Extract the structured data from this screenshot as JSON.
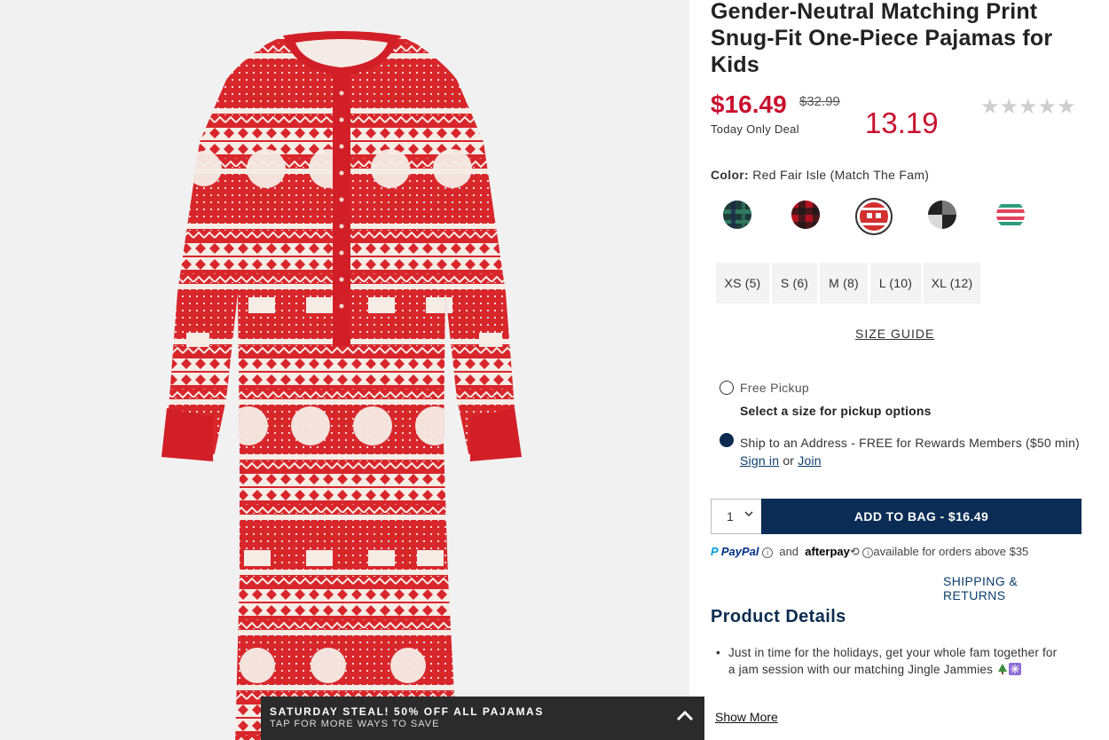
{
  "product": {
    "title": "Gender-Neutral Matching Print Snug-Fit One-Piece Pajamas for Kids",
    "price": "$16.49",
    "original_price": "$32.99",
    "deal_label": "Today Only Deal",
    "promo_price": "13.19",
    "rating_stars": "★★★★★"
  },
  "color": {
    "label": "Color:",
    "value": "Red Fair Isle (Match The Fam)",
    "swatches": [
      {
        "name": "green-plaid",
        "colors": [
          "#1e3d3a",
          "#2e6b55",
          "#1b2a4a"
        ]
      },
      {
        "name": "red-buffalo-check",
        "colors": [
          "#b3121f",
          "#1a1a1a"
        ]
      },
      {
        "name": "red-fair-isle",
        "colors": [
          "#d32f2f",
          "#ffffff"
        ],
        "selected": true
      },
      {
        "name": "black-white-check",
        "colors": [
          "#222222",
          "#d9d9d9"
        ]
      },
      {
        "name": "stripe",
        "colors": [
          "#e2455b",
          "#ffffff",
          "#2f9c7f"
        ]
      }
    ]
  },
  "sizes": [
    "XS (5)",
    "S (6)",
    "M (8)",
    "L (10)",
    "XL (12)"
  ],
  "size_guide": "SIZE GUIDE",
  "fulfillment": {
    "pickup_label": "Free Pickup",
    "pickup_sub": "Select a size for pickup options",
    "ship_text": "Ship to an Address - FREE for Rewards Members ($50 min)",
    "sign_in": "Sign in",
    "or": "or",
    "join": "Join"
  },
  "cart": {
    "quantity": "1",
    "add_to_bag": "ADD TO BAG  -  $16.49"
  },
  "payments": {
    "paypal": "PayPal",
    "and": "and",
    "afterpay": "afterpay",
    "note": "available for orders above $35"
  },
  "shipping_returns": "SHIPPING & RETURNS",
  "details": {
    "title": "Product Details",
    "bullet": "Just in time for the holidays, get your whole fam together for a jam session with our matching Jingle Jammies",
    "show_more": "Show More"
  },
  "promo_bar": {
    "title": "SATURDAY STEAL! 50% OFF ALL PAJAMAS",
    "subtitle": "TAP FOR MORE WAYS TO SAVE"
  },
  "colors": {
    "brand_red": "#c8102e",
    "navy": "#0b2c55",
    "image_bg": "#f2f1f1"
  }
}
